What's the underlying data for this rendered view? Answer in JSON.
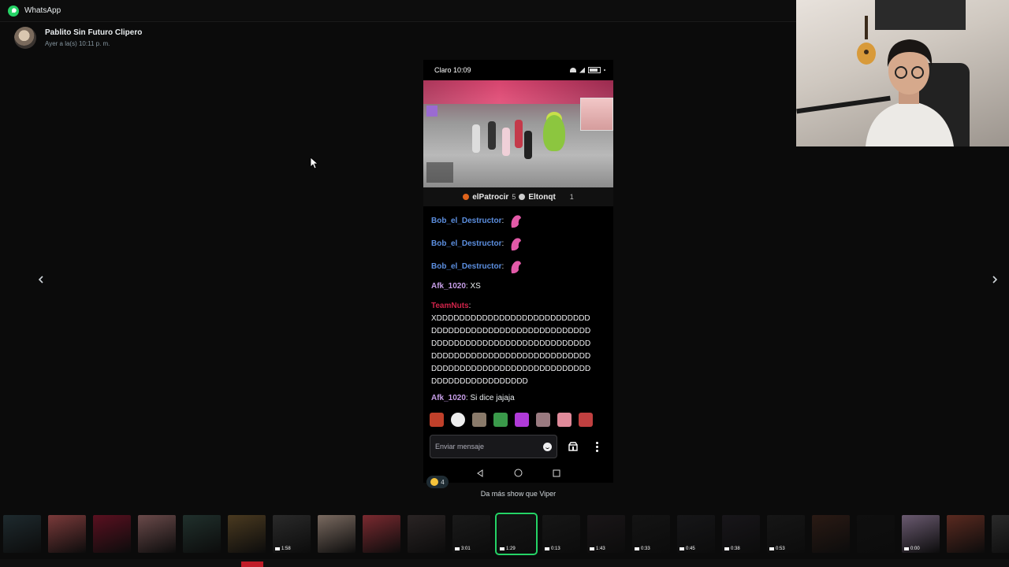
{
  "app": {
    "title": "WhatsApp",
    "accent": "#25d366"
  },
  "sender": {
    "name": "Pablito Sin Futuro Clipero",
    "time": "Ayer a la(s) 10:11 p. m."
  },
  "phone": {
    "carrier_time": "Claro 10:09",
    "streamers": {
      "first": "elPatrocir",
      "first_count": "5",
      "second": "Eltonqt",
      "second_count": "1"
    },
    "chat": [
      {
        "user": "Bob_el_Destructor",
        "sep": ":",
        "text": "",
        "user_color": "#5c8fe0",
        "emote": true
      },
      {
        "user": "Bob_el_Destructor",
        "sep": ":",
        "text": "",
        "user_color": "#5c8fe0",
        "emote": true
      },
      {
        "user": "Bob_el_Destructor",
        "sep": ":",
        "text": "",
        "user_color": "#5c8fe0",
        "emote": true
      },
      {
        "user": "Afk_1020",
        "sep": ":",
        "text": " XS",
        "user_color": "#c79ee8",
        "emote": false
      }
    ],
    "long_message": {
      "user": "TeamNuts",
      "sep": ":",
      "user_color": "#d1244a",
      "lines": [
        "XDDDDDDDDDDDDDDDDDDDDDDDDDDD",
        "DDDDDDDDDDDDDDDDDDDDDDDDDDDD",
        "DDDDDDDDDDDDDDDDDDDDDDDDDDDD",
        "DDDDDDDDDDDDDDDDDDDDDDDDDDDD",
        "DDDDDDDDDDDDDDDDDDDDDDDDDDDD",
        "DDDDDDDDDDDDDDDDD"
      ]
    },
    "last_message": {
      "user": "Afk_1020",
      "sep": ":",
      "text": " Si dice jajaja",
      "user_color": "#c79ee8"
    },
    "input_placeholder": "Enviar mensaje"
  },
  "reaction": {
    "count": "4"
  },
  "caption": "Da más show que Viper",
  "thumbnails": [
    {
      "bg": "#1e2a2e",
      "dur": ""
    },
    {
      "bg": "#7a3a3a",
      "dur": ""
    },
    {
      "bg": "#5a1020",
      "dur": ""
    },
    {
      "bg": "#6a4a4a",
      "dur": ""
    },
    {
      "bg": "#20302c",
      "dur": ""
    },
    {
      "bg": "#4a3a20",
      "dur": ""
    },
    {
      "bg": "#2a2a2a",
      "dur": "1:58"
    },
    {
      "bg": "#7a6a60",
      "dur": ""
    },
    {
      "bg": "#7a2a30",
      "dur": ""
    },
    {
      "bg": "#2a2424",
      "dur": ""
    },
    {
      "bg": "#1a1a1a",
      "dur": "3:01"
    },
    {
      "bg": "#151515",
      "dur": "1:29",
      "selected": true
    },
    {
      "bg": "#161616",
      "dur": "0:13"
    },
    {
      "bg": "#1a1618",
      "dur": "1:43"
    },
    {
      "bg": "#141414",
      "dur": "0:33"
    },
    {
      "bg": "#161618",
      "dur": "0:45"
    },
    {
      "bg": "#18161a",
      "dur": "0:38"
    },
    {
      "bg": "#161616",
      "dur": "0:53"
    },
    {
      "bg": "#2a1a14",
      "dur": ""
    },
    {
      "bg": "#0f0f0f",
      "dur": ""
    },
    {
      "bg": "#6a5a70",
      "dur": "0:00"
    },
    {
      "bg": "#5a2a20",
      "dur": ""
    },
    {
      "bg": "#2a2a2a",
      "dur": ""
    }
  ]
}
